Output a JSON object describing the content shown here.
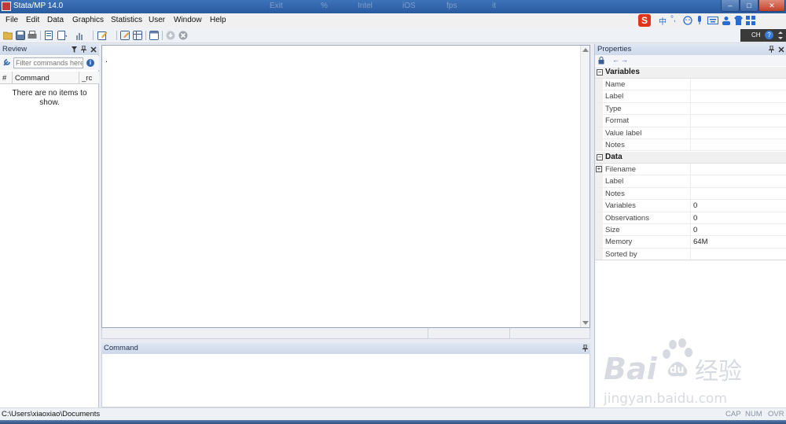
{
  "window": {
    "title": "Stata/MP 14.0",
    "ghost_title_text": [
      "Exit",
      "%",
      "Intel",
      "iOS",
      "fps",
      "it"
    ],
    "minimize_label": "–",
    "maximize_label": "□",
    "close_label": "✕"
  },
  "menu": [
    "File",
    "Edit",
    "Data",
    "Graphics",
    "Statistics",
    "User",
    "Window",
    "Help"
  ],
  "ime_bar": {
    "logo_label": "S",
    "mode_label": "中",
    "punct_label": "°,"
  },
  "toolbar": {
    "icons": [
      "open-icon",
      "save-icon",
      "print-icon",
      "log-icon",
      "viewer-icon",
      "graph-icon",
      "do-file-editor-icon",
      "data-editor-icon",
      "data-browser-icon",
      "variables-manager-icon",
      "more-icon",
      "break-icon"
    ],
    "language_label": "CH",
    "help_label": "?"
  },
  "review": {
    "title": "Review",
    "filter_placeholder": "Filter commands here",
    "columns": [
      "#",
      "Command",
      "_rc"
    ],
    "empty_message": "There are no items to show."
  },
  "results": {
    "prompt": "."
  },
  "command": {
    "title": "Command"
  },
  "properties": {
    "title": "Properties",
    "groups": [
      {
        "name": "Variables",
        "rows": [
          {
            "key": "Name",
            "value": ""
          },
          {
            "key": "Label",
            "value": ""
          },
          {
            "key": "Type",
            "value": ""
          },
          {
            "key": "Format",
            "value": ""
          },
          {
            "key": "Value label",
            "value": ""
          },
          {
            "key": "Notes",
            "value": ""
          }
        ]
      },
      {
        "name": "Data",
        "rows": [
          {
            "key": "Filename",
            "value": ""
          },
          {
            "key": "Label",
            "value": ""
          },
          {
            "key": "Notes",
            "value": ""
          },
          {
            "key": "Variables",
            "value": "0"
          },
          {
            "key": "Observations",
            "value": "0"
          },
          {
            "key": "Size",
            "value": "0"
          },
          {
            "key": "Memory",
            "value": "64M"
          },
          {
            "key": "Sorted by",
            "value": ""
          }
        ]
      }
    ]
  },
  "statusbar": {
    "path": "C:\\Users\\xiaoxiao\\Documents",
    "indicators": [
      "CAP",
      "NUM",
      "OVR"
    ]
  },
  "watermark": {
    "brand": "Bai du 经验",
    "url": "jingyan.baidu.com"
  }
}
